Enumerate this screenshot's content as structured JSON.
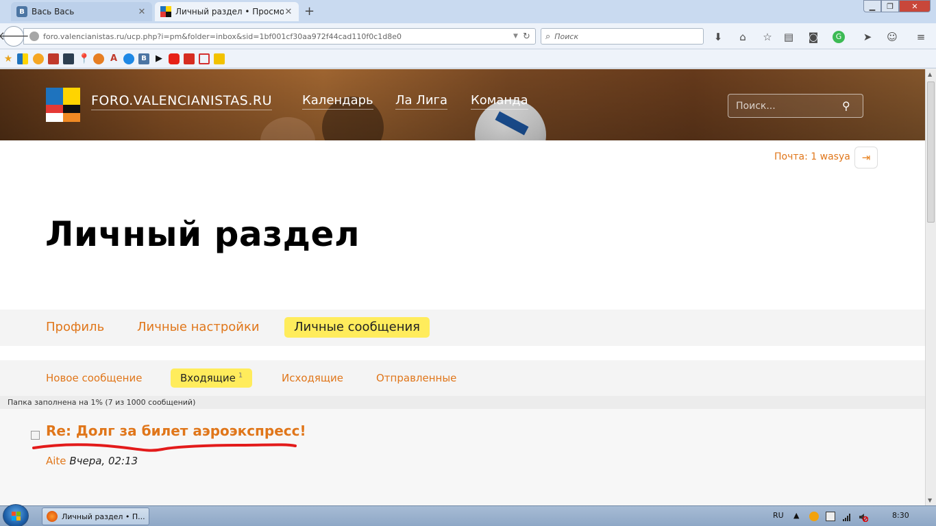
{
  "browser": {
    "tabs": [
      {
        "title": "Вась Вась",
        "active": false
      },
      {
        "title": "Личный раздел • Просмо...",
        "active": true
      }
    ],
    "url": "foro.valencianistas.ru/ucp.php?i=pm&folder=inbox&sid=1bf001cf30aa972f44cad110f0c1d8e0",
    "search_placeholder": "Поиск",
    "icons": [
      "back-icon",
      "download-icon",
      "home-icon",
      "bookmark-star-icon",
      "reading-list-icon",
      "pocket-icon",
      "sync-icon",
      "send-icon",
      "emoji-icon",
      "menu-icon"
    ]
  },
  "site": {
    "brand": "FORO.VALENCIANISTAS.RU",
    "nav": [
      "Календарь",
      "Ла Лига",
      "Команда"
    ],
    "search_placeholder": "Поиск...",
    "mail_link": "Почта: 1 wasya",
    "page_title": "Личный раздел",
    "main_tabs": [
      {
        "label": "Профиль",
        "active": false
      },
      {
        "label": "Личные настройки",
        "active": false
      },
      {
        "label": "Личные сообщения",
        "active": true
      }
    ],
    "sub_tabs": [
      {
        "label": "Новое сообщение",
        "active": false
      },
      {
        "label": "Входящие",
        "badge": "1",
        "active": true
      },
      {
        "label": "Исходящие",
        "active": false
      },
      {
        "label": "Отправленные",
        "active": false
      }
    ],
    "folder_info": "Папка заполнена на 1% (7 из 1000 сообщений)",
    "messages": [
      {
        "subject": "Re: Долг за билет аэроэкспресс!",
        "author": "Aite",
        "date": "Вчера, 02:13"
      }
    ],
    "colors": {
      "accent": "#e0761a",
      "highlight": "#ffec5c",
      "annotation": "#e31b1b"
    }
  },
  "taskbar": {
    "task_title": "Личный раздел • П...",
    "language": "RU",
    "time": "8:30"
  }
}
